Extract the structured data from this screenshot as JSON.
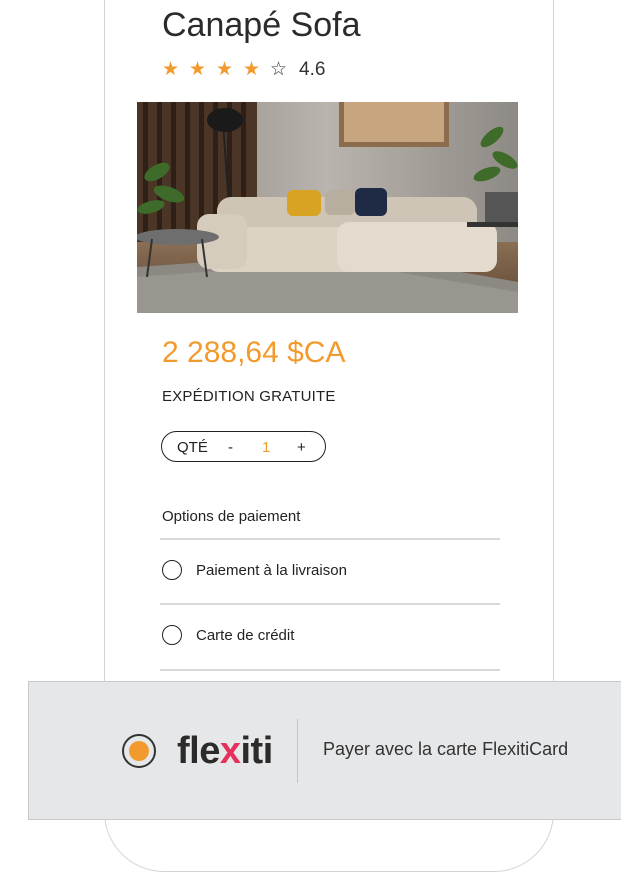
{
  "product": {
    "title": "Canapé Sofa",
    "rating": {
      "value": "4.6",
      "filled_stars": 4,
      "total_stars": 5
    },
    "price": "2 288,64 $CA",
    "shipping": "EXPÉDITION GRATUITE",
    "quantity": {
      "label": "QTÉ",
      "minus": "-",
      "value": "1",
      "plus": "+"
    }
  },
  "payment": {
    "title": "Options de paiement",
    "options": [
      {
        "label": "Paiement à la livraison",
        "selected": false
      },
      {
        "label": "Carte de crédit",
        "selected": false
      }
    ]
  },
  "flexiti_banner": {
    "logo_parts": [
      "fle",
      "x",
      "iti"
    ],
    "text": "Payer avec la carte FlexitiCard",
    "selected": true
  },
  "colors": {
    "accent": "#f29a2e",
    "brand_x": "#e8305c",
    "banner_bg": "#e6e7e8"
  }
}
